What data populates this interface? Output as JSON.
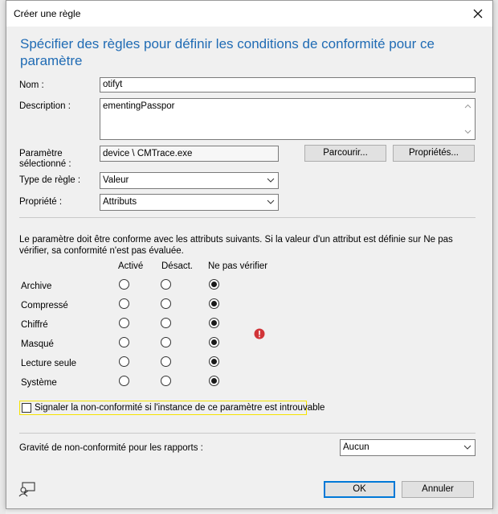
{
  "window": {
    "title": "Créer une règle"
  },
  "heading": "Spécifier des règles pour définir les conditions de conformité pour ce paramètre",
  "form": {
    "name_label": "Nom :",
    "name_value": "otifyt",
    "description_label": "Description :",
    "description_value": "ementingPasspor",
    "selected_setting_label": "Paramètre sélectionné :",
    "selected_setting_value": "device \\ CMTrace.exe",
    "browse_button": "Parcourir...",
    "properties_button": "Propriétés...",
    "rule_type_label": "Type de règle :",
    "rule_type_value": "Valeur",
    "property_label": "Propriété :",
    "property_value": "Attributs"
  },
  "attributes": {
    "description": "Le paramètre doit être conforme avec les attributs suivants. Si la valeur d'un attribut est définie sur Ne pas vérifier, sa conformité n'est pas évaluée.",
    "columns": [
      "Activé",
      "Désact.",
      "Ne pas vérifier"
    ],
    "rows": [
      {
        "label": "Archive",
        "selected": 2
      },
      {
        "label": "Compressé",
        "selected": 2
      },
      {
        "label": "Chiffré",
        "selected": 2
      },
      {
        "label": "Masqué",
        "selected": 2
      },
      {
        "label": "Lecture seule",
        "selected": 2
      },
      {
        "label": "Système",
        "selected": 2
      }
    ],
    "error_icon": "error-icon"
  },
  "report_noncompliance_label": "Signaler la non-conformité si l'instance de ce paramètre est introuvable",
  "severity": {
    "label": "Gravité de non-conformité pour les rapports :",
    "value": "Aucun"
  },
  "buttons": {
    "ok": "OK",
    "cancel": "Annuler"
  },
  "colors": {
    "heading": "#1f6bb4",
    "ok_border": "#0078d7",
    "error": "#d13438",
    "highlight": "#f5e300"
  }
}
